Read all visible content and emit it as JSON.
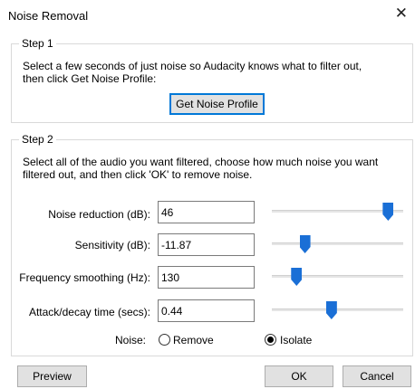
{
  "window": {
    "title": "Noise Removal",
    "close_glyph": "✕"
  },
  "step1": {
    "legend": "Step 1",
    "description_line1": "Select a few seconds of just noise so Audacity knows what to filter out,",
    "description_line2": "then click Get Noise Profile:",
    "get_profile_label": "Get Noise Profile"
  },
  "step2": {
    "legend": "Step 2",
    "description_line1": "Select all of the audio you want filtered, choose how much noise you want",
    "description_line2": "filtered out, and then click 'OK' to remove noise.",
    "params": [
      {
        "label": "Noise reduction (dB):",
        "value": "46",
        "slider_fraction": 0.92
      },
      {
        "label": "Sensitivity (dB):",
        "value": "-11.87",
        "slider_fraction": 0.23
      },
      {
        "label": "Frequency smoothing (Hz):",
        "value": "130",
        "slider_fraction": 0.16
      },
      {
        "label": "Attack/decay time (secs):",
        "value": "0.44",
        "slider_fraction": 0.45
      }
    ],
    "noise_label": "Noise:",
    "noise_options": [
      {
        "label": "Remove",
        "selected": false
      },
      {
        "label": "Isolate",
        "selected": true
      }
    ]
  },
  "footer": {
    "preview_label": "Preview",
    "ok_label": "OK",
    "cancel_label": "Cancel"
  },
  "colors": {
    "accent": "#1a6fd6",
    "focus_border": "#0078d7",
    "button_face": "#e1e1e1"
  }
}
